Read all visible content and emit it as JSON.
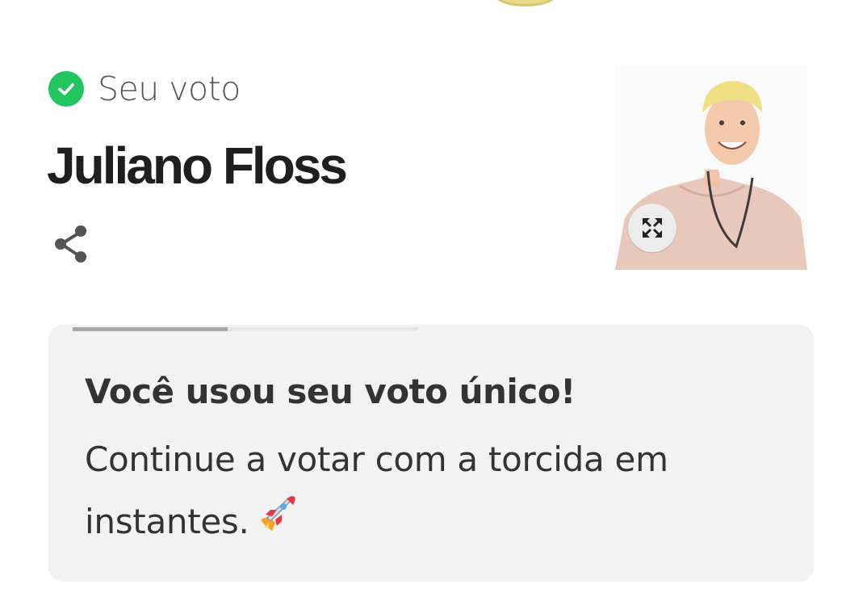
{
  "vote": {
    "status_label": "Seu voto",
    "candidate_name": "Juliano Floss"
  },
  "message": {
    "title": "Você usou seu voto único!",
    "text": "Continue a votar com a torcida em instantes.",
    "progress": 0.45
  },
  "icons": {
    "status": "check-circle-icon",
    "share": "share-icon",
    "expand": "expand-icon",
    "message_emoji": "rocket-icon"
  },
  "colors": {
    "check": "#22c55e",
    "card_bg": "#f2f2f2",
    "progress_fill": "#a8a8a8"
  }
}
